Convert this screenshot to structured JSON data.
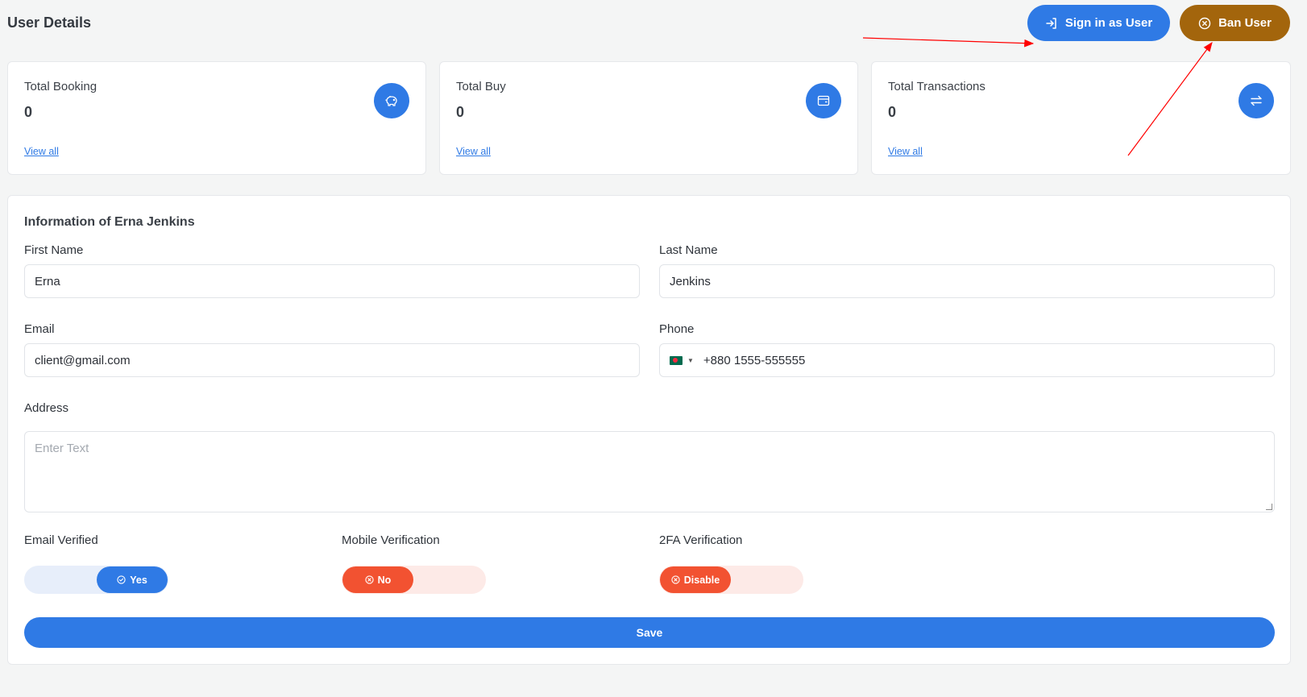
{
  "header": {
    "title": "User Details",
    "sign_in_label": "Sign in as User",
    "ban_label": "Ban User"
  },
  "stats": [
    {
      "label": "Total Booking",
      "value": "0",
      "link": "View all",
      "icon": "piggy-bank-icon"
    },
    {
      "label": "Total Buy",
      "value": "0",
      "link": "View all",
      "icon": "wallet-icon"
    },
    {
      "label": "Total Transactions",
      "value": "0",
      "link": "View all",
      "icon": "transfer-arrows-icon"
    }
  ],
  "info": {
    "title": "Information of Erna Jenkins",
    "first_name_label": "First Name",
    "first_name_value": "Erna",
    "last_name_label": "Last Name",
    "last_name_value": "Jenkins",
    "email_label": "Email",
    "email_value": "client@gmail.com",
    "phone_label": "Phone",
    "phone_value": "+880 1555-555555",
    "address_label": "Address",
    "address_placeholder": "Enter Text",
    "email_verified_label": "Email Verified",
    "email_verified_value": "Yes",
    "mobile_verification_label": "Mobile Verification",
    "mobile_verification_value": "No",
    "twofa_label": "2FA Verification",
    "twofa_value": "Disable",
    "save_label": "Save"
  },
  "colors": {
    "primary": "#2f7ae5",
    "ban": "#a3650c",
    "danger": "#f25231",
    "annotation": "#ff0000"
  }
}
